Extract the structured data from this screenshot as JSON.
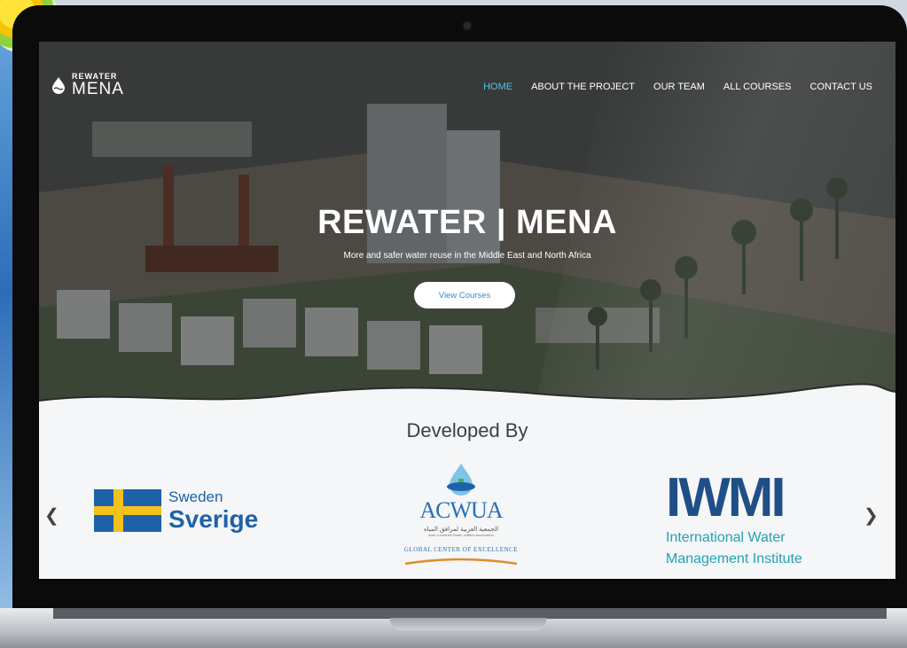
{
  "site": {
    "logo_top": "REWATER",
    "logo_bottom": "MENA"
  },
  "nav": {
    "items": [
      "HOME",
      "ABOUT THE PROJECT",
      "OUR TEAM",
      "ALL COURSES",
      "CONTACT US"
    ],
    "active_index": 0,
    "active_color": "#4ec3e8"
  },
  "hero": {
    "title": "REWATER | MENA",
    "subtitle": "More and safer water reuse in the Middle East and North Africa",
    "button_label": "View Courses"
  },
  "partners_section": {
    "heading": "Developed By",
    "prev_icon": "chevron-left-icon",
    "next_icon": "chevron-right-icon",
    "sweden": {
      "line1": "Sweden",
      "line2": "Sverige"
    },
    "acwua": {
      "name": "ACWUA",
      "arabic": "الجمعية العربية لمرافق المياه",
      "sub": "Arab Countries Water Utilities Association",
      "tagline": "GLOBAL CENTER OF EXCELLENCE"
    },
    "iwmi": {
      "mark": "IWMI",
      "line1": "International Water",
      "line2": "Management Institute"
    }
  },
  "colors": {
    "brand_blue": "#1f61a8",
    "iwmi_navy": "#1f4f87",
    "iwmi_teal": "#24a0b8",
    "button_text": "#2a8fd6"
  }
}
